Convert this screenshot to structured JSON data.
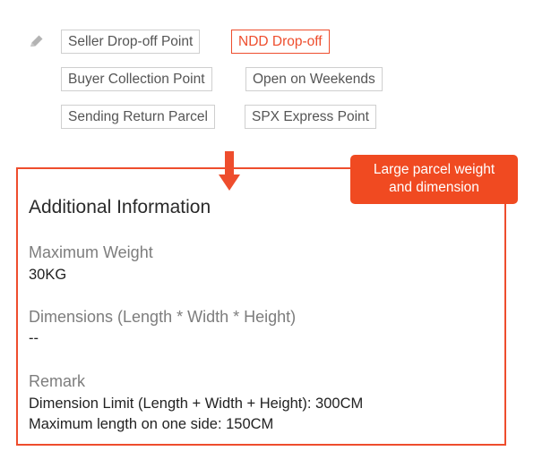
{
  "tags": [
    {
      "label": "Seller Drop-off Point",
      "active": false
    },
    {
      "label": "NDD Drop-off",
      "active": true
    },
    {
      "label": "Buyer Collection Point",
      "active": false
    },
    {
      "label": "Open on Weekends",
      "active": false
    },
    {
      "label": "Sending Return Parcel",
      "active": false
    },
    {
      "label": "SPX Express Point",
      "active": false
    }
  ],
  "icons": {
    "edit": "pencil-icon",
    "pointer": "down-arrow-icon"
  },
  "callout": {
    "line1": "Large parcel weight",
    "line2": "and dimension"
  },
  "info": {
    "title": "Additional Information",
    "max_weight_label": "Maximum Weight",
    "max_weight_value": "30KG",
    "dimensions_label": "Dimensions (Length * Width * Height)",
    "dimensions_value": "--",
    "remark_label": "Remark",
    "remark_line1": "Dimension Limit (Length + Width + Height): 300CM",
    "remark_line2": "Maximum length on one side: 150CM"
  },
  "colors": {
    "accent": "#ee4d2d",
    "callout_bg": "#f04a21",
    "tag_border": "#cfcfcf",
    "muted_text": "#7d7d7d"
  }
}
